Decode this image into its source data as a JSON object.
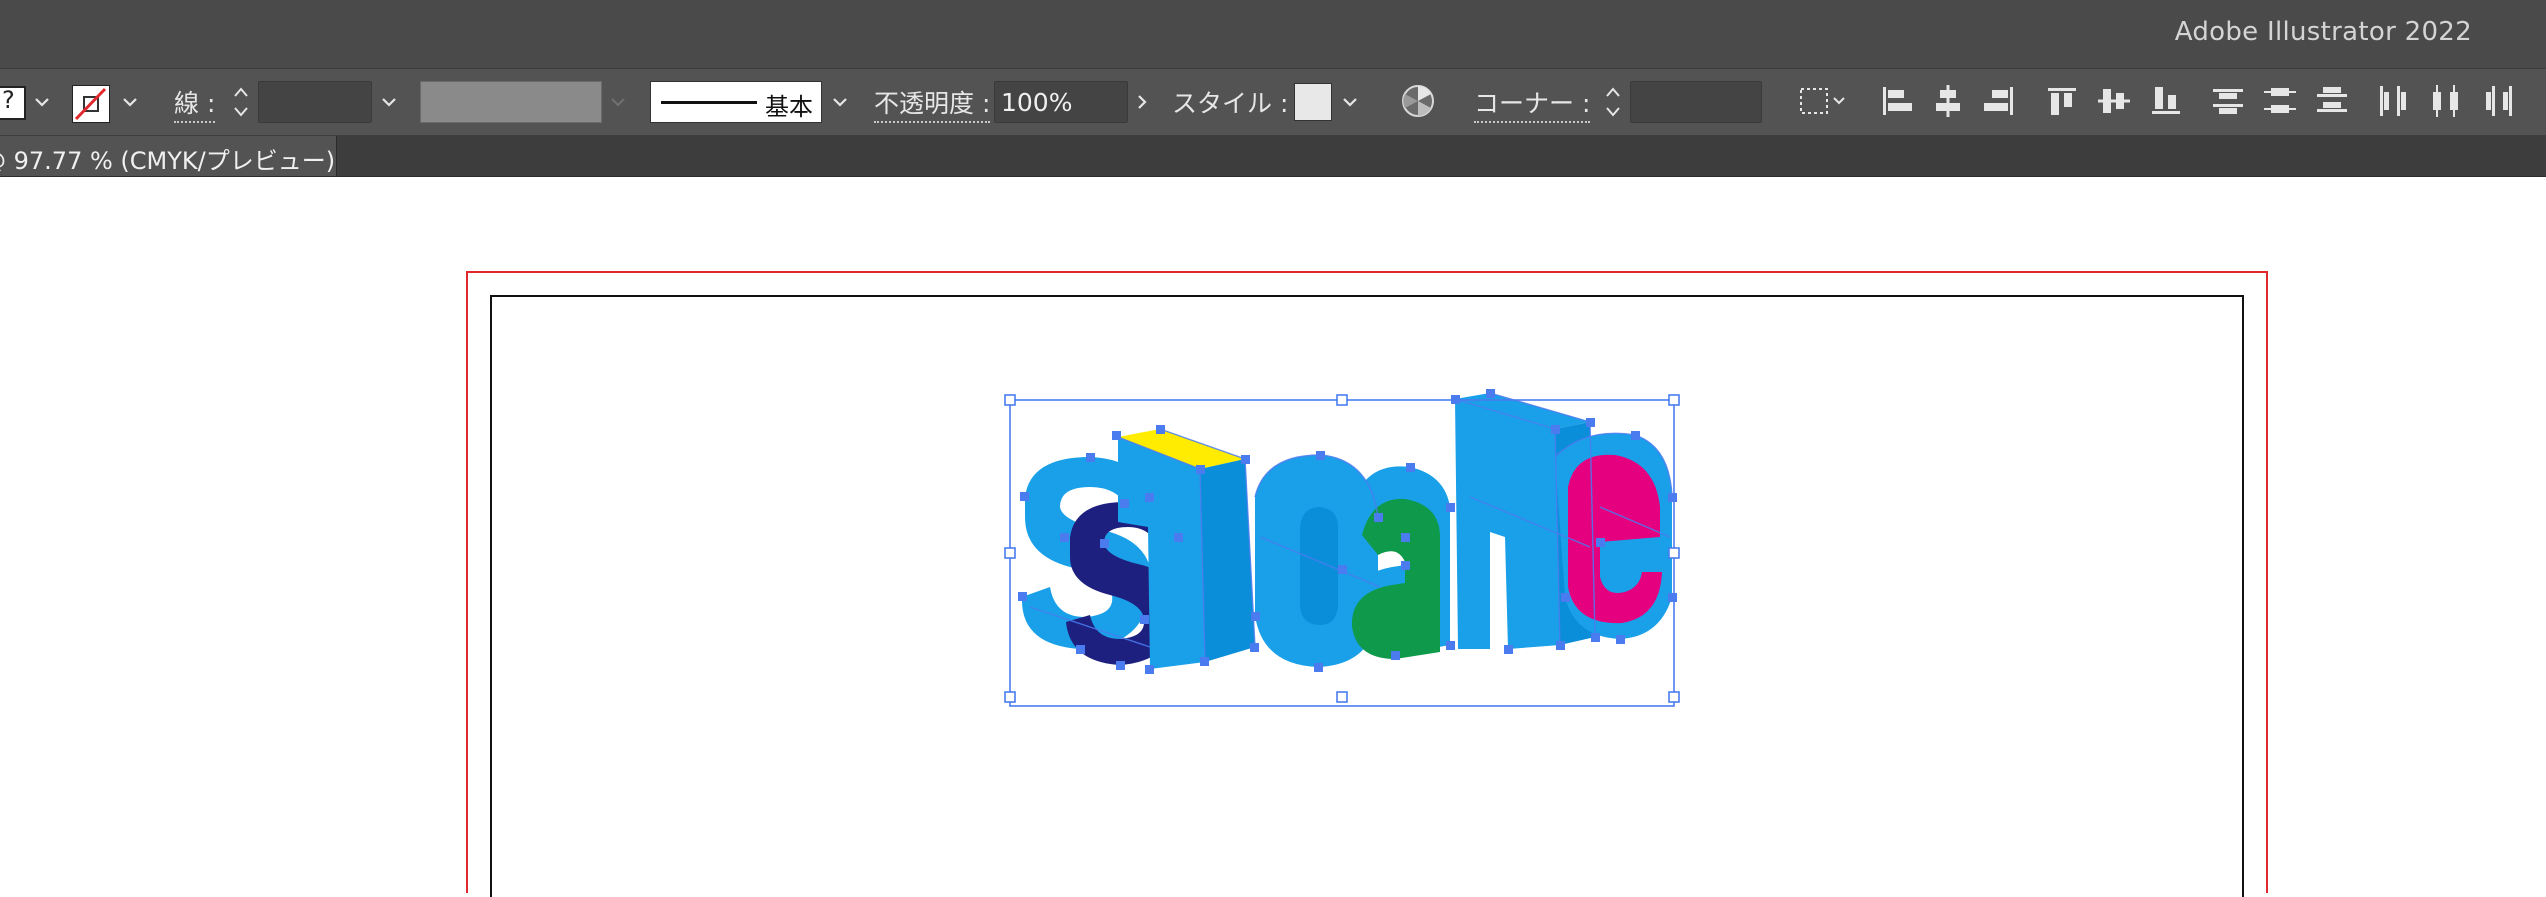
{
  "app": {
    "title": "Adobe Illustrator 2022"
  },
  "control_bar": {
    "fill_swatch_label": "?",
    "stroke_label": "線 :",
    "stroke_weight_value": "",
    "stroke_profile_label": "基本",
    "opacity_label": "不透明度 :",
    "opacity_value": "100%",
    "style_label": "スタイル :",
    "corner_label": "コーナー :",
    "corner_value": ""
  },
  "document_tab": {
    "label": "@ 97.77 % (CMYK/プレビュー)"
  },
  "colors": {
    "titlebar": "#4a4a4a",
    "controlbar": "#535353",
    "bleed_guide": "#e0282d",
    "selection": "#4a7cf0",
    "letter_front": "#1aa0e8",
    "letter_side": "#0b8ed9",
    "navy": "#1e2080",
    "green": "#0e9a4a",
    "magenta": "#e4007f",
    "yellow": "#ffec00"
  },
  "icons": {
    "align": [
      "align-left-icon",
      "align-hcenter-icon",
      "align-right-icon",
      "align-top-icon",
      "align-vcenter-icon",
      "align-bottom-icon",
      "distribute-top-icon",
      "distribute-vcenter-icon",
      "distribute-bottom-icon",
      "distribute-left-icon",
      "distribute-hcenter-icon",
      "distribute-right-icon"
    ]
  }
}
